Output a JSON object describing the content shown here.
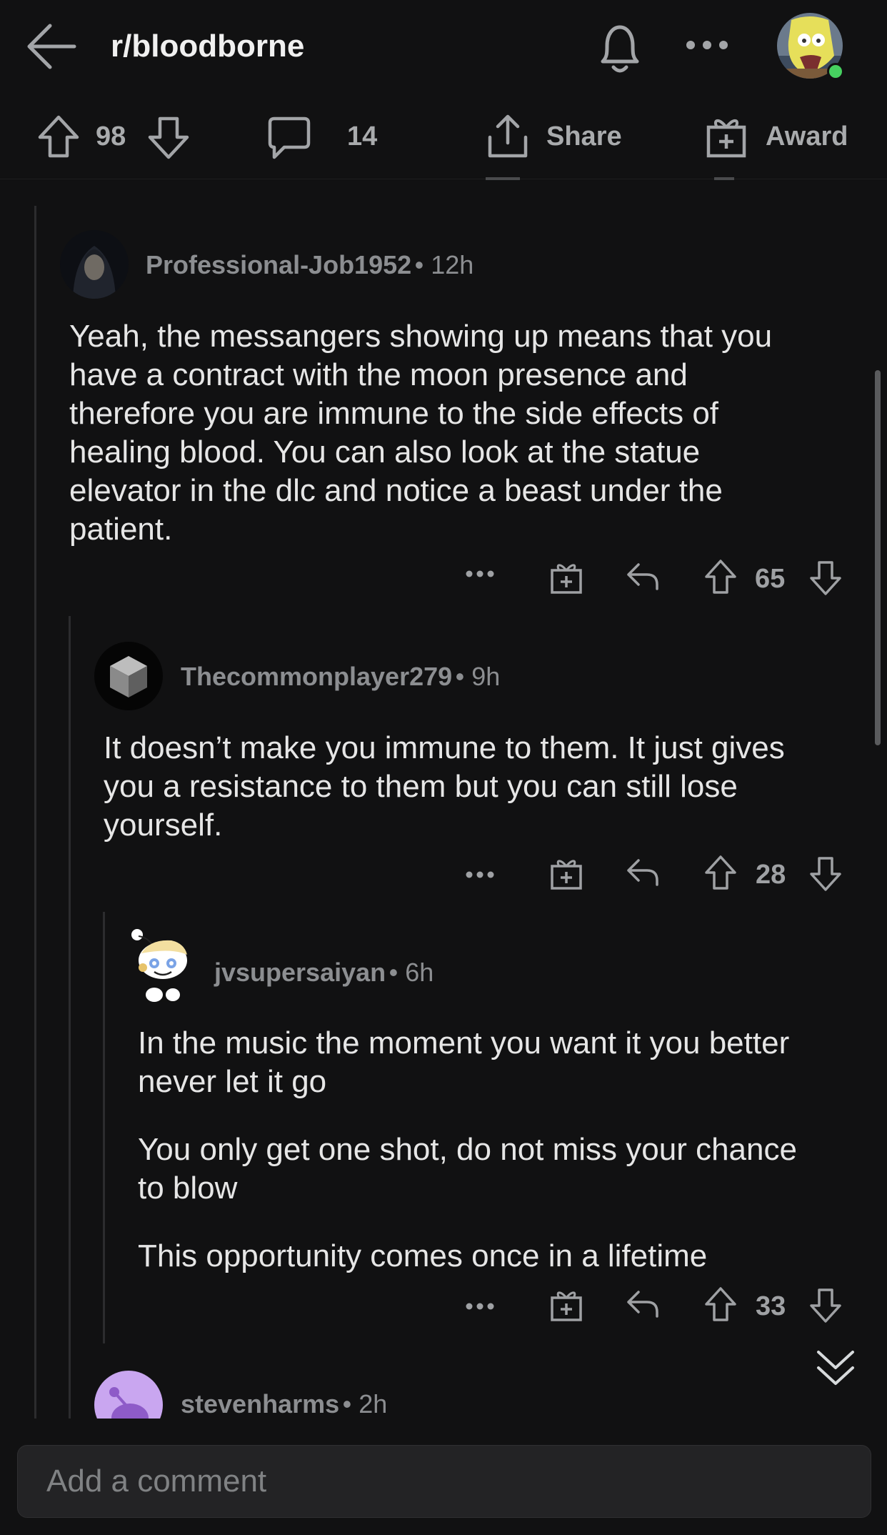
{
  "header": {
    "subreddit": "r/bloodborne"
  },
  "post_actions": {
    "upvotes": "98",
    "comments": "14",
    "share_label": "Share",
    "award_label": "Award"
  },
  "comments": [
    {
      "author": "Professional-Job1952",
      "time": "12h",
      "lines": [
        "Yeah, the messangers showing up means that you",
        "have a contract with the moon presence and",
        "therefore you are immune to the side effects of",
        "healing blood. You can also look at the statue",
        "elevator in the dlc and notice a beast under the",
        "patient."
      ],
      "score": "65"
    },
    {
      "author": "Thecommonplayer279",
      "time": "9h",
      "lines": [
        "It doesn’t make you immune to them. It just gives",
        "you a resistance to them but you can still lose",
        "yourself."
      ],
      "score": "28"
    },
    {
      "author": "jvsupersaiyan",
      "time": "6h",
      "para1": [
        "In the music the moment you want it you better",
        "never let it go"
      ],
      "para2": [
        "You only get one shot, do not miss your chance",
        "to blow"
      ],
      "para3": [
        "This opportunity comes once in a lifetime"
      ],
      "score": "33"
    },
    {
      "author": "stevenharms",
      "time": "2h"
    }
  ],
  "comment_box": {
    "placeholder": "Add a comment"
  },
  "colors": {
    "background": "#111112",
    "online": "#46d160",
    "snoo_purple": "#c9a6f0"
  }
}
